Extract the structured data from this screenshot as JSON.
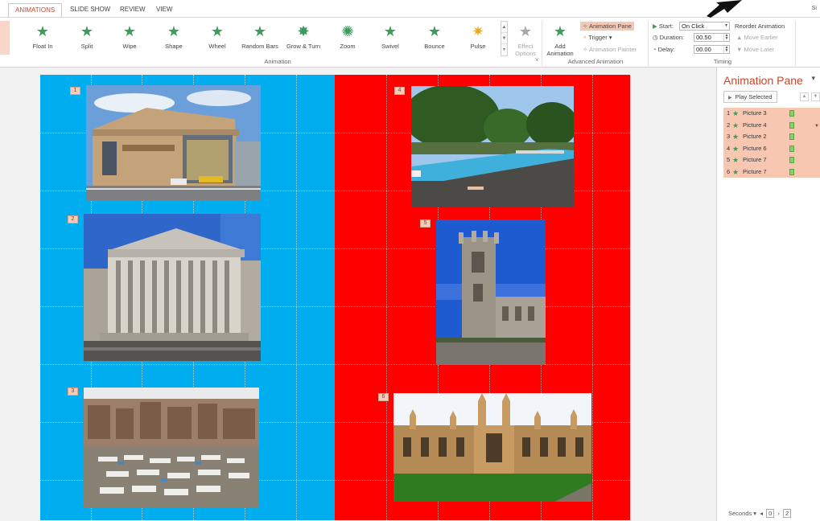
{
  "tabs": [
    {
      "label": "ANIMATIONS",
      "active": true
    },
    {
      "label": "SLIDE SHOW",
      "active": false
    },
    {
      "label": "REVIEW",
      "active": false
    },
    {
      "label": "VIEW",
      "active": false
    }
  ],
  "account_label": "Si",
  "ribbon": {
    "gallery": [
      {
        "label": "Float In",
        "icon": "star-green"
      },
      {
        "label": "Split",
        "icon": "star-green"
      },
      {
        "label": "Wipe",
        "icon": "star-green"
      },
      {
        "label": "Shape",
        "icon": "star-green"
      },
      {
        "label": "Wheel",
        "icon": "star-green"
      },
      {
        "label": "Random Bars",
        "icon": "star-green"
      },
      {
        "label": "Grow & Turn",
        "icon": "star-green"
      },
      {
        "label": "Zoom",
        "icon": "star-green"
      },
      {
        "label": "Swivel",
        "icon": "star-green"
      },
      {
        "label": "Bounce",
        "icon": "star-green"
      },
      {
        "label": "Pulse",
        "icon": "star-gold"
      }
    ],
    "effect_options": "Effect Options",
    "animation_group_label": "Animation",
    "add_animation": "Add Animation",
    "animation_pane_btn": "Animation Pane",
    "trigger_btn": "Trigger",
    "animation_painter_btn": "Animation Painter",
    "advanced_group_label": "Advanced Animation",
    "start_label": "Start:",
    "start_value": "On Click",
    "duration_label": "Duration:",
    "duration_value": "00.50",
    "delay_label": "Delay:",
    "delay_value": "00.00",
    "reorder_label": "Reorder Animation",
    "move_earlier": "Move Earlier",
    "move_later": "Move Later",
    "timing_group_label": "Timing"
  },
  "slide": {
    "left_color": "#00adef",
    "right_color": "#ff0000",
    "tags": [
      "1",
      "2",
      "3",
      "4",
      "5",
      "6"
    ]
  },
  "animation_pane": {
    "title": "Animation Pane",
    "play_selected": "Play Selected",
    "items": [
      {
        "number": "1",
        "name": "Picture 3"
      },
      {
        "number": "2",
        "name": "Picture 4"
      },
      {
        "number": "3",
        "name": "Picture 2"
      },
      {
        "number": "4",
        "name": "Picture 6"
      },
      {
        "number": "5",
        "name": "Picture 7"
      },
      {
        "number": "6",
        "name": "Picture 7"
      }
    ],
    "seconds_label": "Seconds",
    "timeline_start": "0",
    "timeline_next": "2"
  },
  "colors": {
    "accent": "#c5482b",
    "selection": "#f8c7b2",
    "star_green": "#3f9a5e"
  }
}
